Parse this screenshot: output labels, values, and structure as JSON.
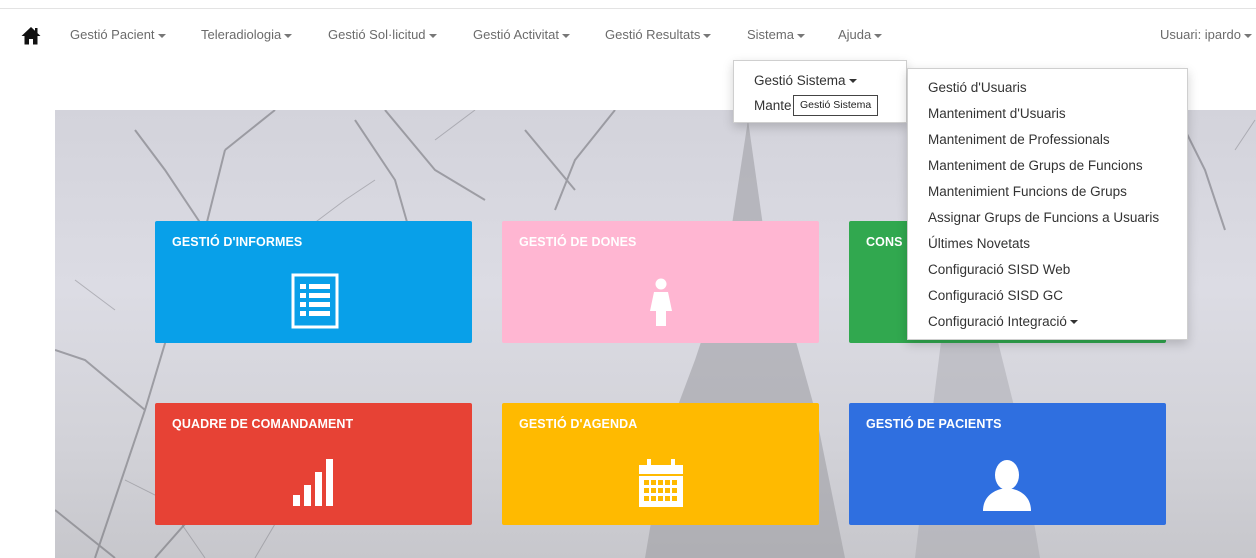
{
  "nav": {
    "items": [
      {
        "label": "Gestió Pacient"
      },
      {
        "label": "Teleradiologia"
      },
      {
        "label": "Gestió Sol·licitud"
      },
      {
        "label": "Gestió Activitat"
      },
      {
        "label": "Gestió Resultats"
      },
      {
        "label": "Sistema"
      },
      {
        "label": "Ajuda"
      }
    ],
    "user_label": "Usuari: ipardo"
  },
  "sistema_menu": {
    "items": [
      {
        "label": "Gestió Sistema"
      },
      {
        "label": "Mante"
      }
    ],
    "tooltip": "Gestió Sistema"
  },
  "gestio_sistema_submenu": {
    "items": [
      {
        "label": "Gestió d'Usuaris"
      },
      {
        "label": "Manteniment d'Usuaris"
      },
      {
        "label": "Manteniment de Professionals"
      },
      {
        "label": "Manteniment de Grups de Funcions"
      },
      {
        "label": "Mantenimient Funcions de Grups"
      },
      {
        "label": "Assignar Grups de Funcions a Usuaris"
      },
      {
        "label": "Últimes Novetats"
      },
      {
        "label": "Configuració SISD Web"
      },
      {
        "label": "Configuració SISD GC"
      },
      {
        "label": "Configuració Integració"
      }
    ]
  },
  "tiles": [
    {
      "title": "GESTIÓ D'INFORMES",
      "color": "#08a0e9",
      "icon": "report-icon"
    },
    {
      "title": "GESTIÓ DE DONES",
      "color": "#ffb6d2",
      "icon": "woman-icon"
    },
    {
      "title": "CONS",
      "color": "#31a84f",
      "icon": ""
    },
    {
      "title": "QUADRE DE COMANDAMENT",
      "color": "#e74235",
      "icon": "bar-chart-icon"
    },
    {
      "title": "GESTIÓ D'AGENDA",
      "color": "#ffba00",
      "icon": "calendar-icon"
    },
    {
      "title": "GESTIÓ DE PACIENTS",
      "color": "#2f6fe0",
      "icon": "user-icon"
    }
  ]
}
